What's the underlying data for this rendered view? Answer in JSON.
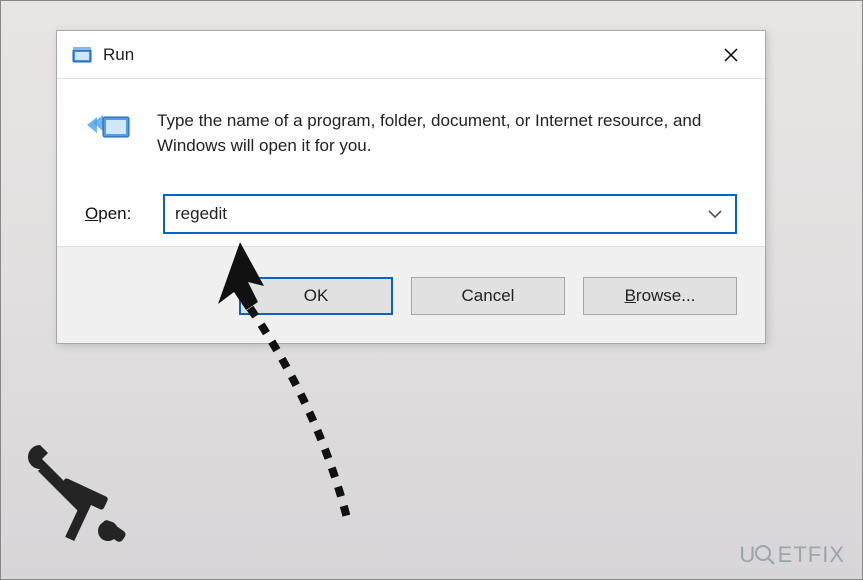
{
  "dialog": {
    "title": "Run",
    "description": "Type the name of a program, folder, document, or Internet resource, and Windows will open it for you.",
    "open_label_prefix": "O",
    "open_label_rest": "pen:",
    "input_value": "regedit",
    "input_placeholder": "",
    "buttons": {
      "ok": "OK",
      "cancel": "Cancel",
      "browse_prefix": "B",
      "browse_rest": "rowse..."
    }
  },
  "watermark": {
    "prefix": "U",
    "mid": "ETFI",
    "suffix": "X"
  }
}
